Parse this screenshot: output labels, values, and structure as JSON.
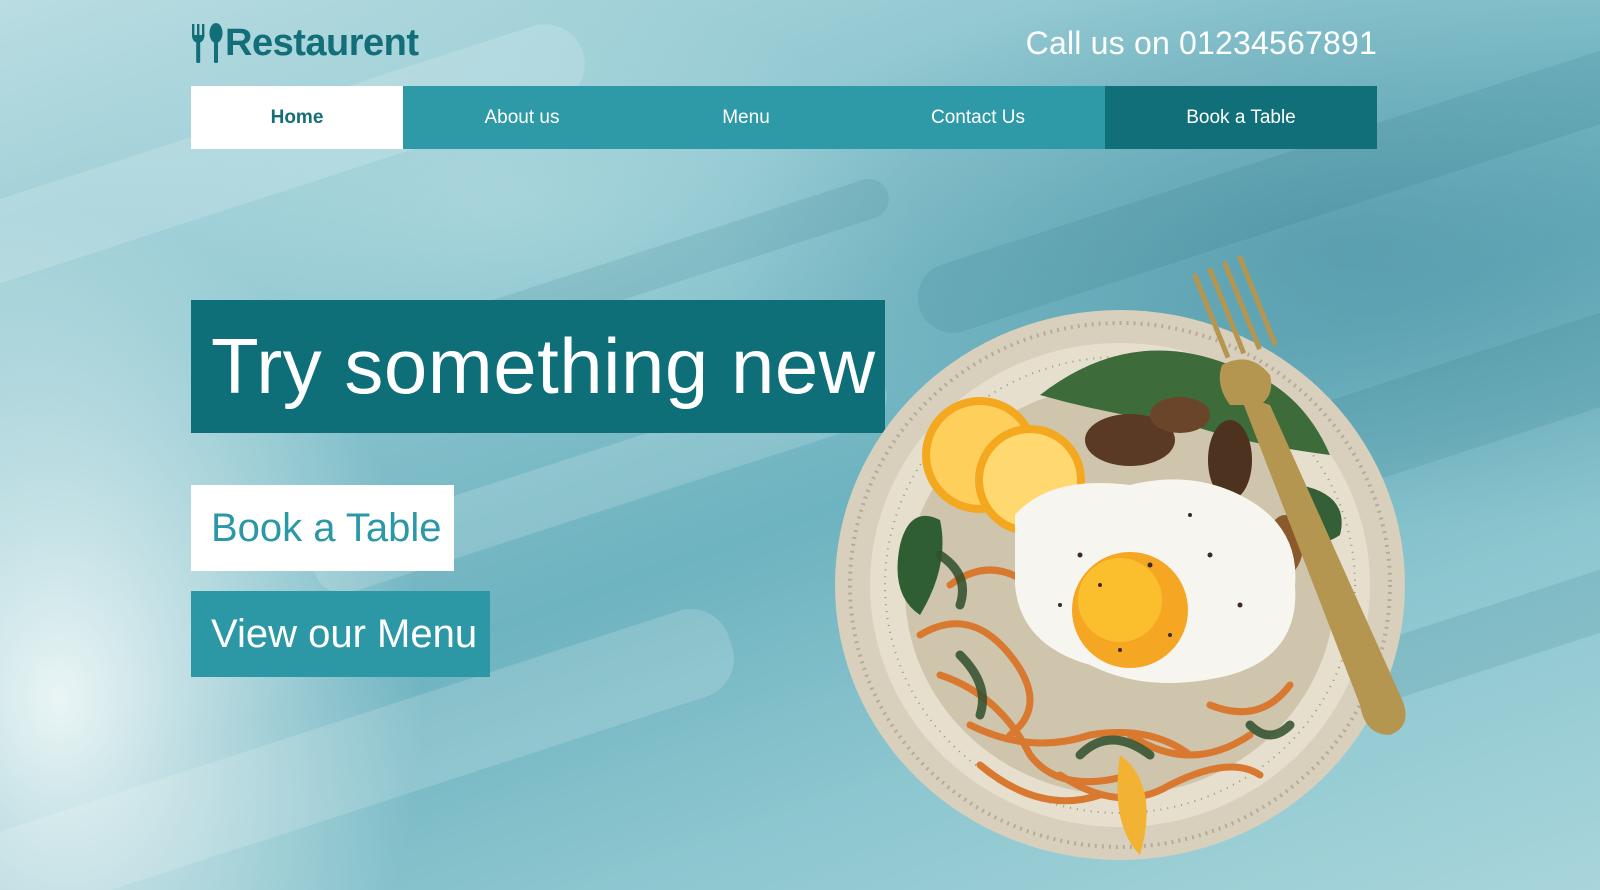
{
  "brand": {
    "name": "Restaurent",
    "icon": "fork-spoon-icon",
    "color": "#126e78"
  },
  "header": {
    "phone_text": "Call us on 01234567891"
  },
  "nav": {
    "items": [
      {
        "label": "Home",
        "active": true
      },
      {
        "label": "About us"
      },
      {
        "label": "Menu"
      },
      {
        "label": "Contact Us"
      }
    ],
    "cta_label": "Book a Table"
  },
  "hero": {
    "title": "Try something new",
    "book_label": "Book a Table",
    "menu_label": "View our Menu",
    "image": "food-bowl-with-egg-and-fork"
  },
  "colors": {
    "primary_dark": "#0f6f79",
    "primary": "#2e9aa8",
    "background": "#8fc6cf",
    "white": "#ffffff"
  }
}
